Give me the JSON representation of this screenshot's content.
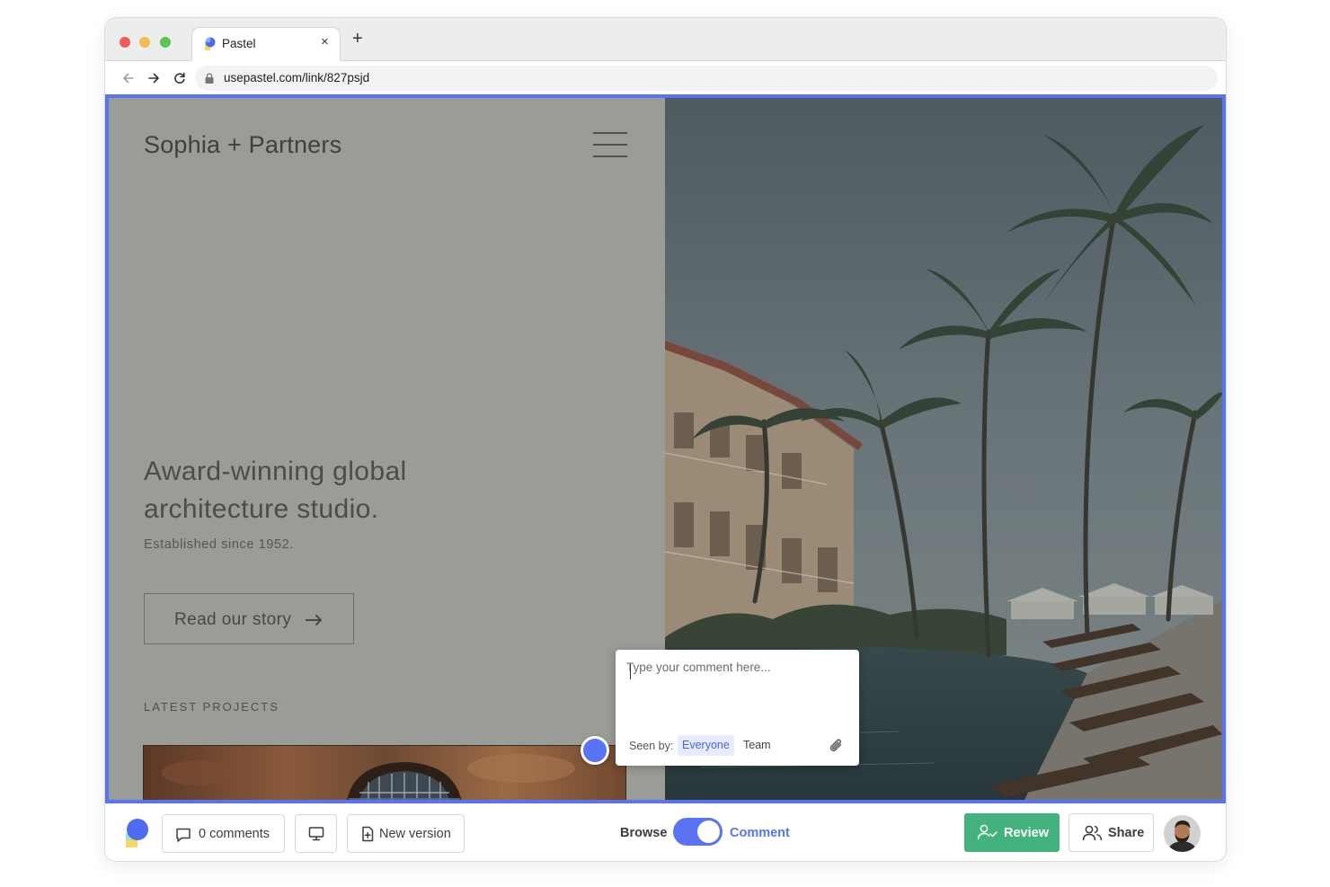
{
  "browser": {
    "tab_title": "Pastel",
    "tab_close": "×",
    "new_tab": "+",
    "url": "usepastel.com/link/827psjd"
  },
  "site": {
    "brand": "Sophia + Partners",
    "headline_line1": "Award-winning global",
    "headline_line2": "architecture studio.",
    "subheadline": "Established since 1952.",
    "cta_label": "Read our story",
    "section_label": "LATEST PROJECTS"
  },
  "comment_popover": {
    "placeholder": "Type your comment here...",
    "seen_by_label": "Seen by:",
    "audience_options": [
      "Everyone",
      "Team"
    ],
    "audience_selected": "Everyone"
  },
  "toolbar": {
    "comments_label": "0 comments",
    "new_version_label": "New version",
    "browse_label": "Browse",
    "comment_mode_label": "Comment",
    "mode_toggle_on": true,
    "review_label": "Review",
    "share_label": "Share"
  },
  "colors": {
    "accent": "#5a73f2",
    "review_green": "#43b27e",
    "page_overlay": "#9a9c97"
  }
}
